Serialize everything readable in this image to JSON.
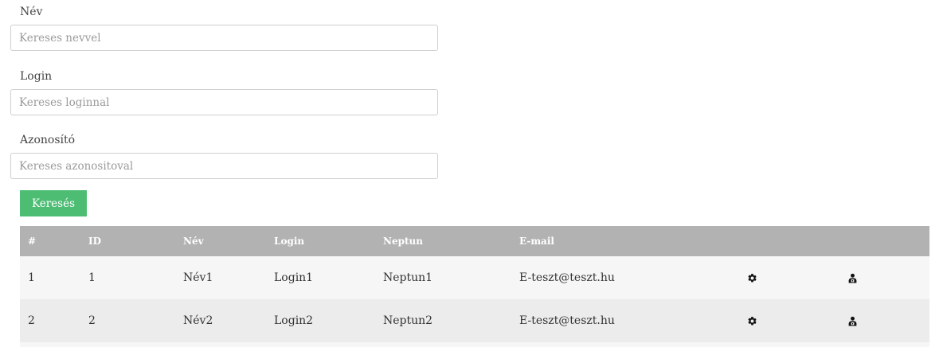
{
  "filters": [
    {
      "label": "Név",
      "placeholder": "Kereses nevvel"
    },
    {
      "label": "Login",
      "placeholder": "Kereses loginnal"
    },
    {
      "label": "Azonosító",
      "placeholder": "Kereses azonositoval"
    }
  ],
  "search_button": "Keresés",
  "table": {
    "headers": [
      "#",
      "ID",
      "Név",
      "Login",
      "Neptun",
      "E-mail"
    ],
    "rows": [
      {
        "num": "1",
        "id": "1",
        "name": "Név1",
        "login": "Login1",
        "neptun": "Neptun1",
        "email": "E-teszt@teszt.hu"
      },
      {
        "num": "2",
        "id": "2",
        "name": "Név2",
        "login": "Login2",
        "neptun": "Neptun2",
        "email": "E-teszt@teszt.hu"
      }
    ]
  },
  "icons": {
    "settings": "gear-icon",
    "permissions": "user-lock-icon"
  },
  "colors": {
    "accent": "#4dbd74",
    "table_header": "#b2b2b2",
    "row_odd": "#f6f6f6",
    "row_even": "#ececec"
  }
}
